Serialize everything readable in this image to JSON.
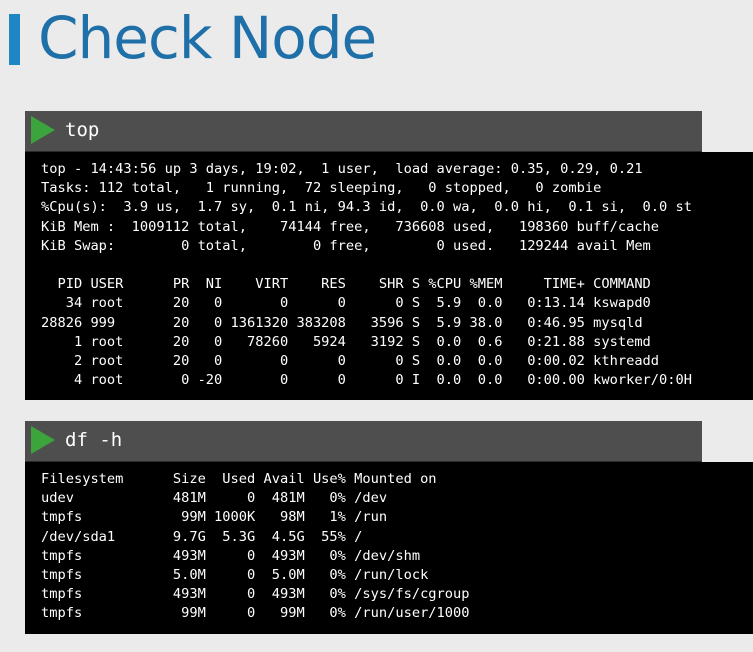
{
  "slide": {
    "title": "Check Node"
  },
  "top_panel": {
    "command": "top",
    "summary": [
      "top - 14:43:56 up 3 days, 19:02,  1 user,  load average: 0.35, 0.29, 0.21",
      "Tasks: 112 total,   1 running,  72 sleeping,   0 stopped,   0 zombie",
      "%Cpu(s):  3.9 us,  1.7 sy,  0.1 ni, 94.3 id,  0.0 wa,  0.0 hi,  0.1 si,  0.0 st",
      "KiB Mem :  1009112 total,    74144 free,   736608 used,   198360 buff/cache",
      "KiB Swap:        0 total,        0 free,        0 used.   129244 avail Mem"
    ],
    "table_header": "  PID USER      PR  NI    VIRT    RES    SHR S %CPU %MEM     TIME+ COMMAND",
    "rows": [
      "   34 root      20   0       0      0      0 S  5.9  0.0   0:13.14 kswapd0",
      "28826 999       20   0 1361320 383208   3596 S  5.9 38.0   0:46.95 mysqld",
      "    1 root      20   0   78260   5924   3192 S  0.0  0.6   0:21.88 systemd",
      "    2 root      20   0       0      0      0 S  0.0  0.0   0:00.02 kthreadd",
      "    4 root       0 -20       0      0      0 I  0.0  0.0   0:00.00 kworker/0:0H"
    ]
  },
  "df_panel": {
    "command": "df -h",
    "table_header": "Filesystem      Size  Used Avail Use% Mounted on",
    "rows": [
      "udev            481M     0  481M   0% /dev",
      "tmpfs            99M 1000K   98M   1% /run",
      "/dev/sda1       9.7G  5.3G  4.5G  55% /",
      "tmpfs           493M     0  493M   0% /dev/shm",
      "tmpfs           5.0M     0  5.0M   0% /run/lock",
      "tmpfs           493M     0  493M   0% /sys/fs/cgroup",
      "tmpfs            99M     0   99M   0% /run/user/1000"
    ]
  },
  "colors": {
    "accent": "#1f86c6",
    "title": "#1f6fa8",
    "play": "#3ba43d",
    "terminal_bg": "#000000",
    "bar_bg": "#4e4e4e"
  },
  "icons": {
    "title_accent": "accent-bar",
    "command_marker": "play-icon"
  }
}
